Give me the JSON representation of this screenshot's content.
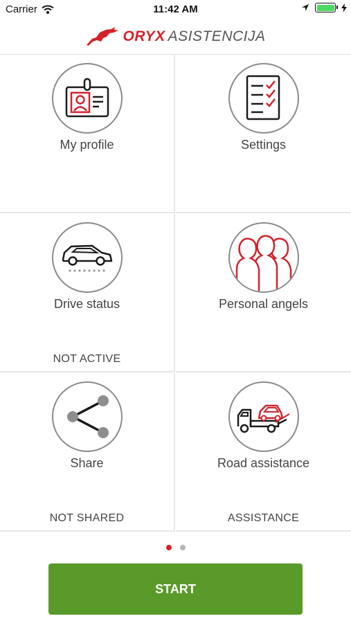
{
  "status_bar": {
    "carrier": "Carrier",
    "time": "11:42 AM",
    "battery_level": 1.0
  },
  "logo": {
    "brand": "ORYX",
    "suffix": "ASISTENCIJA",
    "brand_color": "#d5212a"
  },
  "tiles": [
    {
      "label": "My profile",
      "status": "",
      "icon": "id-badge-icon"
    },
    {
      "label": "Settings",
      "status": "",
      "icon": "checklist-icon"
    },
    {
      "label": "Drive status",
      "status": "NOT ACTIVE",
      "icon": "car-icon"
    },
    {
      "label": "Personal angels",
      "status": "",
      "icon": "people-group-icon"
    },
    {
      "label": "Share",
      "status": "NOT SHARED",
      "icon": "share-icon"
    },
    {
      "label": "Road assistance",
      "status": "ASSISTANCE",
      "icon": "tow-truck-icon"
    }
  ],
  "pagination": {
    "current_page": 1,
    "total_pages": 2
  },
  "start_button": {
    "label": "START"
  },
  "colors": {
    "accent": "#d5212a",
    "start": "#5a9a2a",
    "icon_stroke": "#1a1a1a"
  }
}
